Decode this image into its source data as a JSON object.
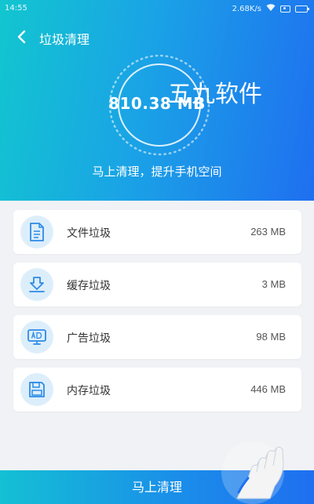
{
  "status_bar": {
    "time": "14:55",
    "network_speed": "2.68K/s"
  },
  "header": {
    "back_icon": "chevron-left-icon",
    "title": "垃圾清理",
    "total_size": "810.38 MB",
    "watermark": "五九软件",
    "subtitle": "马上清理，提升手机空间"
  },
  "items": [
    {
      "label": "文件垃圾",
      "size": "263 MB",
      "icon": "file-icon"
    },
    {
      "label": "缓存垃圾",
      "size": "3 MB",
      "icon": "download-cache-icon"
    },
    {
      "label": "广告垃圾",
      "size": "98 MB",
      "icon": "ad-icon"
    },
    {
      "label": "内存垃圾",
      "size": "446 MB",
      "icon": "memory-card-icon"
    }
  ],
  "clean_button": {
    "label": "马上清理"
  },
  "colors": {
    "accent": "#1f8fe8",
    "icon_blue": "#2d8be6",
    "icon_bg": "#ddeefb"
  }
}
